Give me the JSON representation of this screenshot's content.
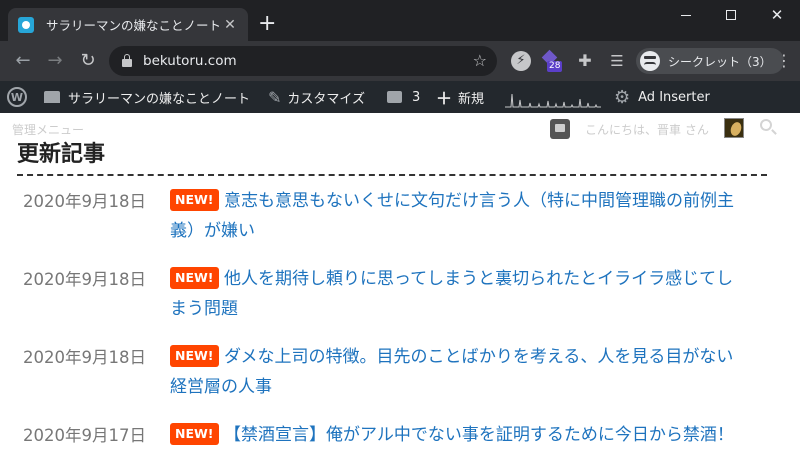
{
  "browser": {
    "tab_title": "サラリーマンの嫌なことノート",
    "new_tab": "+",
    "url": "bekutoru.com",
    "extension_badge": "28",
    "incognito_label": "シークレット（3）"
  },
  "adminbar": {
    "site_name": "サラリーマンの嫌なことノート",
    "customize": "カスタマイズ",
    "comments_count": "3",
    "new_label": "新規",
    "ad_inserter": "Ad Inserter"
  },
  "page": {
    "admin_menu_label": "管理メニュー",
    "greeting": "こんにちは、晋車 さん",
    "section_title": "更新記事",
    "new_badge": "NEW!",
    "posts": [
      {
        "date": "2020年9月18日",
        "title_line1": "意志も意思もないくせに文句だけ言う人（特に中間管理職の前例主",
        "title_line2": "義）が嫌い"
      },
      {
        "date": "2020年9月18日",
        "title_line1": "他人を期待し頼りに思ってしまうと裏切られたとイライラ感じてし",
        "title_line2": "まう問題"
      },
      {
        "date": "2020年9月18日",
        "title_line1": "ダメな上司の特徴。目先のことばかりを考える、人を見る目がない",
        "title_line2": "経営層の人事"
      },
      {
        "date": "2020年9月17日",
        "title_line1": "【禁酒宣言】俺がアル中でない事を証明するために今日から禁酒！",
        "title_line2": ""
      }
    ]
  },
  "icons": {
    "tab": "site-favicon",
    "toolbar": [
      "back-arrow-icon",
      "forward-arrow-icon",
      "reload-icon",
      "lock-icon",
      "star-icon",
      "extension-icon",
      "puzzle-icon",
      "reading-list-icon",
      "incognito-icon",
      "kebab-menu-icon"
    ],
    "adminbar": [
      "wordpress-logo-icon",
      "home-icon",
      "brush-icon",
      "comment-icon",
      "plus-icon",
      "gear-icon"
    ]
  },
  "colors": {
    "link": "#1e73be",
    "new_badge": "#ff4500",
    "adminbar_bg": "#23282d",
    "chrome_dark": "#202124"
  }
}
